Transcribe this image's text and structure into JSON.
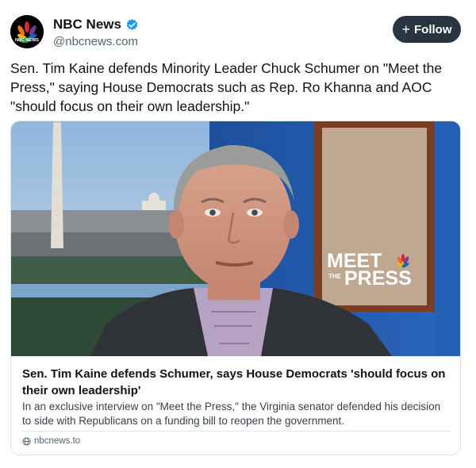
{
  "author": {
    "display_name": "NBC News",
    "handle": "@nbcnews.com",
    "avatar_text": "NBC NEWS",
    "verified": true
  },
  "follow_button": {
    "icon": "+",
    "label": "Follow"
  },
  "post": {
    "text": "Sen. Tim Kaine defends Minority Leader Chuck Schumer on \"Meet the Press,\" saying House Democrats such as Rep. Ro Khanna and AOC \"should focus on their own leadership.\""
  },
  "link_card": {
    "image_overlay_text_line1": "MEET",
    "image_overlay_text_line2_small": "THE",
    "image_overlay_text_line2": "PRESS",
    "title": "Sen. Tim Kaine defends Schumer, says House Democrats 'should focus on their own leadership'",
    "description": "In an exclusive interview on \"Meet the Press,\" the Virginia senator defended his decision to side with Republicans on a funding bill to reopen the government.",
    "source": "nbcnews.to"
  },
  "colors": {
    "follow_bg": "#283441",
    "verified_blue": "#1d9bf0",
    "secondary_text": "#536471"
  }
}
